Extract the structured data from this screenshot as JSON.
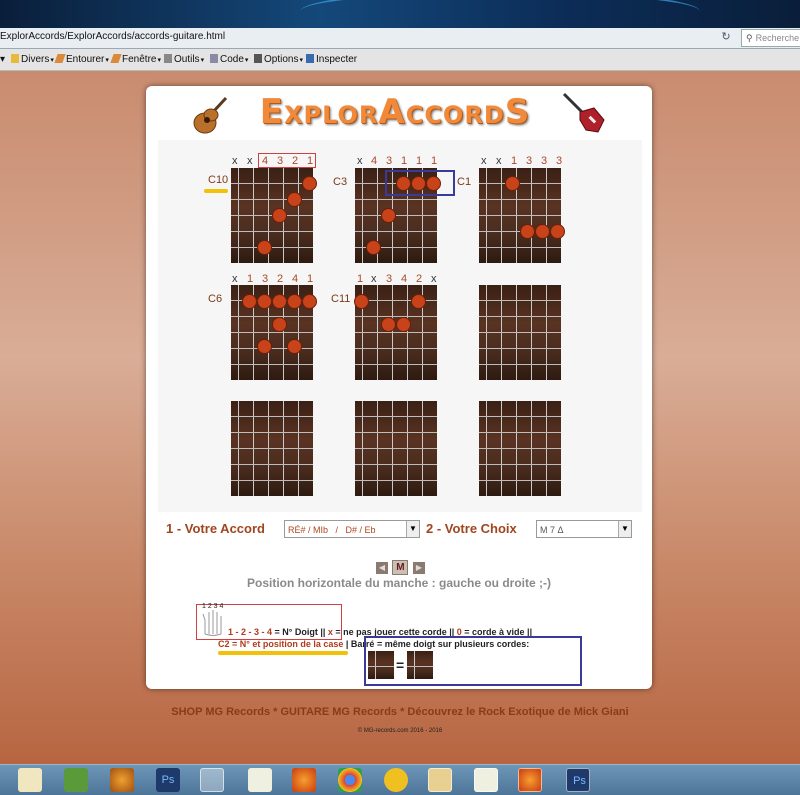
{
  "browser": {
    "url": "ExplorAccords/ExplorAccords/accords-guitare.html",
    "search_placeholder": "Recherche",
    "toolbar": [
      {
        "label": "Divers",
        "icon": "folder-icon"
      },
      {
        "label": "Entourer",
        "icon": "pencil-icon"
      },
      {
        "label": "Fenêtre",
        "icon": "pencil-icon"
      },
      {
        "label": "Outils",
        "icon": "tools-icon"
      },
      {
        "label": "Code",
        "icon": "code-icon"
      },
      {
        "label": "Options",
        "icon": "options-icon"
      },
      {
        "label": "Inspecter",
        "icon": "inspect-icon"
      }
    ]
  },
  "app": {
    "title": "ExplorAccordS",
    "colors": {
      "accent": "#a0461e",
      "dot": "#c8421a",
      "highlight": "#f2c10a",
      "box_red": "#d04040",
      "box_blue": "#3a3a9a"
    }
  },
  "chords": [
    {
      "label": "C10",
      "markers": [
        "x",
        "x",
        "4",
        "3",
        "2",
        "1"
      ]
    },
    {
      "label": "C3",
      "label_right": "C1",
      "markers": [
        "x",
        "4",
        "3",
        "1",
        "1",
        "1"
      ]
    },
    {
      "label": "",
      "markers": [
        "x",
        "x",
        "1",
        "3",
        "3",
        "3"
      ]
    },
    {
      "label": "C6",
      "markers": [
        "x",
        "1",
        "3",
        "2",
        "4",
        "1"
      ]
    },
    {
      "label": "C11",
      "markers": [
        "1",
        "x",
        "3",
        "4",
        "2",
        "x"
      ]
    },
    {
      "label": "",
      "markers": []
    },
    {
      "label": "",
      "markers": []
    },
    {
      "label": "",
      "markers": []
    },
    {
      "label": "",
      "markers": []
    }
  ],
  "controls": {
    "label1": "1 - Votre Accord",
    "select1": "RÉ# / MIb   /   D# / Eb",
    "label2": "2 - Votre Choix",
    "select2": "M 7 Δ"
  },
  "nav": {
    "prev": "◀",
    "mid": "M",
    "next": "▶"
  },
  "position_text": "Position horizontale du manche : gauche ou droite ;-)",
  "legend": {
    "hand_numbers": "1 2 3 4",
    "line1_fingers": "1 - 2 - 3 - 4",
    "line1_a": " = N° Doigt || ",
    "line1_x": "x",
    "line1_b": " = ne pas jouer cette corde || ",
    "line1_0": "0",
    "line1_c": " = corde à vide ||",
    "line2_c2": "C2",
    "line2_a": " = N° et position de la case",
    "line2_b": " | Barré = même doigt sur plusieurs cordes:",
    "equals": "="
  },
  "footer": {
    "links": "SHOP MG Records * GUITARE MG Records * Découvrez le Rock Exotique de Mick Giani",
    "copyright": "© MG-records.com 2016 - 2016"
  },
  "taskbar": [
    "notepad-icon",
    "app-green-icon",
    "gear-orange-icon",
    "photoshop-icon",
    "tools-icon",
    "notepad2-icon",
    "firefox-icon",
    "chrome-icon",
    "app-yellow-icon",
    "folder-icon",
    "notepad3-icon",
    "firefox2-icon",
    "photoshop2-icon"
  ]
}
